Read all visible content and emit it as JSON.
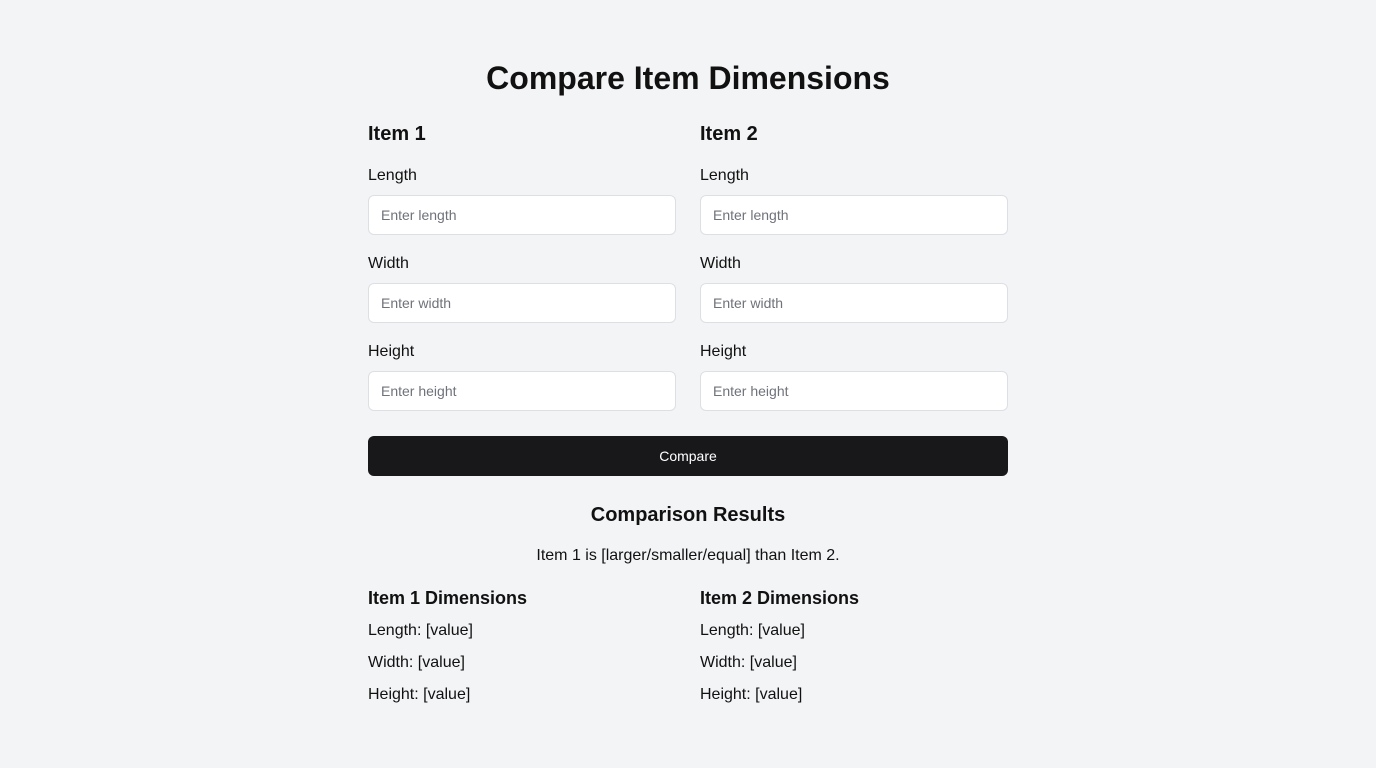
{
  "page": {
    "title": "Compare Item Dimensions"
  },
  "form": {
    "item1": {
      "heading": "Item 1",
      "length_label": "Length",
      "length_placeholder": "Enter length",
      "width_label": "Width",
      "width_placeholder": "Enter width",
      "height_label": "Height",
      "height_placeholder": "Enter height"
    },
    "item2": {
      "heading": "Item 2",
      "length_label": "Length",
      "length_placeholder": "Enter length",
      "width_label": "Width",
      "width_placeholder": "Enter width",
      "height_label": "Height",
      "height_placeholder": "Enter height"
    },
    "compare_label": "Compare"
  },
  "results": {
    "title": "Comparison Results",
    "summary": "Item 1 is [larger/smaller/equal] than Item 2.",
    "item1": {
      "heading": "Item 1 Dimensions",
      "length": "Length: [value]",
      "width": "Width: [value]",
      "height": "Height: [value]"
    },
    "item2": {
      "heading": "Item 2 Dimensions",
      "length": "Length: [value]",
      "width": "Width: [value]",
      "height": "Height: [value]"
    }
  },
  "colors": {
    "background": "#f3f4f6",
    "button": "#18181b",
    "button_text": "#ffffff",
    "input_border": "#dcdfe4",
    "placeholder": "#6f727a"
  }
}
